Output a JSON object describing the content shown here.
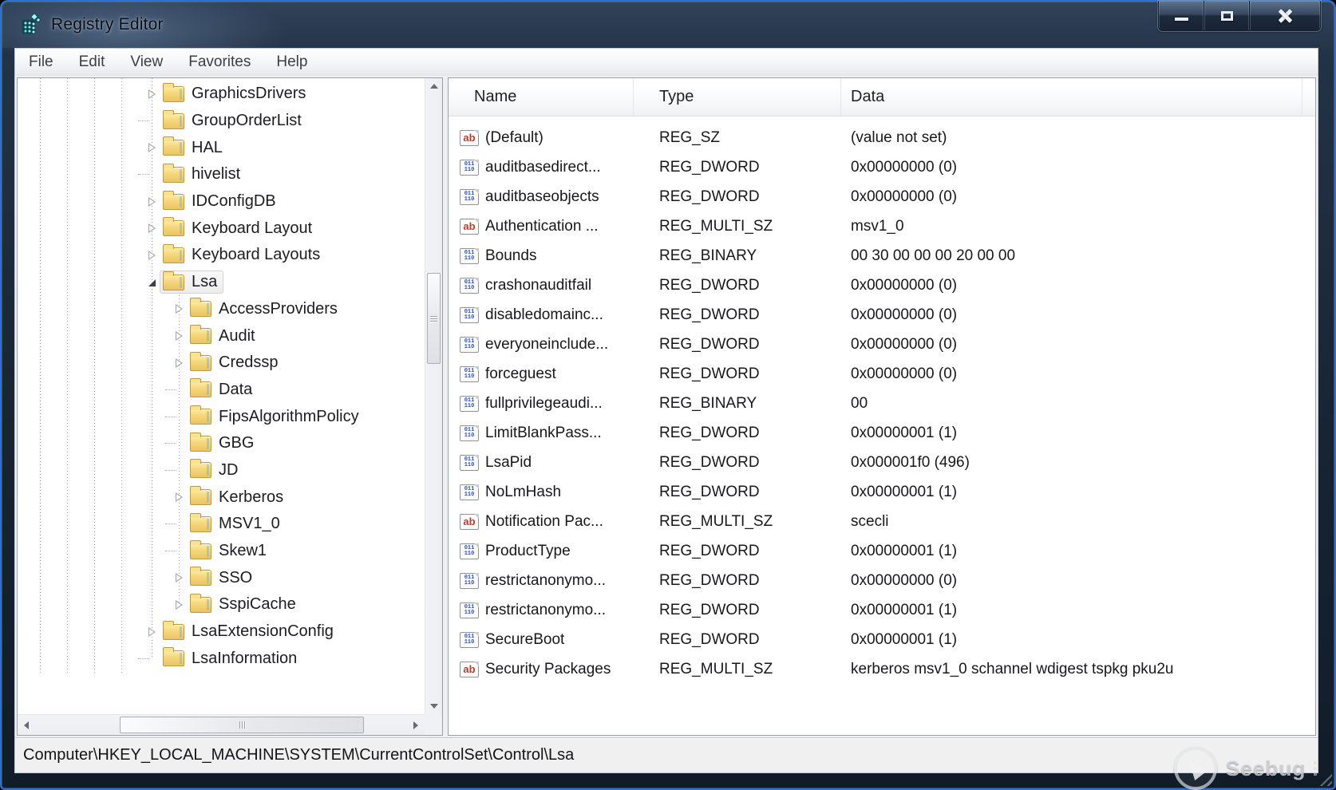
{
  "window": {
    "title": "Registry Editor",
    "controls": [
      {
        "name": "minimize",
        "glyph": "minimize-bar"
      },
      {
        "name": "maximize",
        "glyph": "maximize-square"
      },
      {
        "name": "close",
        "glyph": "close-x"
      }
    ]
  },
  "menu": {
    "items": [
      "File",
      "Edit",
      "View",
      "Favorites",
      "Help"
    ]
  },
  "tree": {
    "items": [
      {
        "label": "GraphicsDrivers",
        "level": 0,
        "state": "collapsed",
        "selected": false
      },
      {
        "label": "GroupOrderList",
        "level": 0,
        "state": "leaf",
        "selected": false
      },
      {
        "label": "HAL",
        "level": 0,
        "state": "collapsed",
        "selected": false
      },
      {
        "label": "hivelist",
        "level": 0,
        "state": "leaf",
        "selected": false
      },
      {
        "label": "IDConfigDB",
        "level": 0,
        "state": "collapsed",
        "selected": false
      },
      {
        "label": "Keyboard Layout",
        "level": 0,
        "state": "collapsed",
        "selected": false
      },
      {
        "label": "Keyboard Layouts",
        "level": 0,
        "state": "collapsed",
        "selected": false
      },
      {
        "label": "Lsa",
        "level": 0,
        "state": "expanded",
        "selected": true
      },
      {
        "label": "AccessProviders",
        "level": 1,
        "state": "collapsed",
        "selected": false
      },
      {
        "label": "Audit",
        "level": 1,
        "state": "collapsed",
        "selected": false
      },
      {
        "label": "Credssp",
        "level": 1,
        "state": "collapsed",
        "selected": false
      },
      {
        "label": "Data",
        "level": 1,
        "state": "leaf",
        "selected": false
      },
      {
        "label": "FipsAlgorithmPolicy",
        "level": 1,
        "state": "leaf",
        "selected": false
      },
      {
        "label": "GBG",
        "level": 1,
        "state": "leaf",
        "selected": false
      },
      {
        "label": "JD",
        "level": 1,
        "state": "leaf",
        "selected": false
      },
      {
        "label": "Kerberos",
        "level": 1,
        "state": "collapsed",
        "selected": false
      },
      {
        "label": "MSV1_0",
        "level": 1,
        "state": "leaf",
        "selected": false
      },
      {
        "label": "Skew1",
        "level": 1,
        "state": "leaf",
        "selected": false
      },
      {
        "label": "SSO",
        "level": 1,
        "state": "collapsed",
        "selected": false
      },
      {
        "label": "SspiCache",
        "level": 1,
        "state": "collapsed",
        "selected": false
      },
      {
        "label": "LsaExtensionConfig",
        "level": 0,
        "state": "collapsed",
        "selected": false
      },
      {
        "label": "LsaInformation",
        "level": 0,
        "state": "leaf",
        "selected": false
      }
    ]
  },
  "list": {
    "columns": [
      "Name",
      "Type",
      "Data"
    ],
    "rows": [
      {
        "icon": "string",
        "name": "(Default)",
        "type": "REG_SZ",
        "data": "(value not set)"
      },
      {
        "icon": "binary",
        "name": "auditbasedirect...",
        "type": "REG_DWORD",
        "data": "0x00000000 (0)"
      },
      {
        "icon": "binary",
        "name": "auditbaseobjects",
        "type": "REG_DWORD",
        "data": "0x00000000 (0)"
      },
      {
        "icon": "string",
        "name": "Authentication ...",
        "type": "REG_MULTI_SZ",
        "data": "msv1_0"
      },
      {
        "icon": "binary",
        "name": "Bounds",
        "type": "REG_BINARY",
        "data": "00 30 00 00 00 20 00 00"
      },
      {
        "icon": "binary",
        "name": "crashonauditfail",
        "type": "REG_DWORD",
        "data": "0x00000000 (0)"
      },
      {
        "icon": "binary",
        "name": "disabledomainc...",
        "type": "REG_DWORD",
        "data": "0x00000000 (0)"
      },
      {
        "icon": "binary",
        "name": "everyoneinclude...",
        "type": "REG_DWORD",
        "data": "0x00000000 (0)"
      },
      {
        "icon": "binary",
        "name": "forceguest",
        "type": "REG_DWORD",
        "data": "0x00000000 (0)"
      },
      {
        "icon": "binary",
        "name": "fullprivilegeaudi...",
        "type": "REG_BINARY",
        "data": "00"
      },
      {
        "icon": "binary",
        "name": "LimitBlankPass...",
        "type": "REG_DWORD",
        "data": "0x00000001 (1)"
      },
      {
        "icon": "binary",
        "name": "LsaPid",
        "type": "REG_DWORD",
        "data": "0x000001f0 (496)"
      },
      {
        "icon": "binary",
        "name": "NoLmHash",
        "type": "REG_DWORD",
        "data": "0x00000001 (1)"
      },
      {
        "icon": "string",
        "name": "Notification Pac...",
        "type": "REG_MULTI_SZ",
        "data": "scecli"
      },
      {
        "icon": "binary",
        "name": "ProductType",
        "type": "REG_DWORD",
        "data": "0x00000001 (1)"
      },
      {
        "icon": "binary",
        "name": "restrictanonymo...",
        "type": "REG_DWORD",
        "data": "0x00000000 (0)"
      },
      {
        "icon": "binary",
        "name": "restrictanonymo...",
        "type": "REG_DWORD",
        "data": "0x00000001 (1)"
      },
      {
        "icon": "binary",
        "name": "SecureBoot",
        "type": "REG_DWORD",
        "data": "0x00000001 (1)"
      },
      {
        "icon": "string",
        "name": "Security Packages",
        "type": "REG_MULTI_SZ",
        "data": "kerberos msv1_0 schannel wdigest tspkg pku2u"
      }
    ],
    "icon_glyphs": {
      "string": "ab",
      "binary_top": "011",
      "binary_bottom": "110"
    }
  },
  "statusbar": {
    "path": "Computer\\HKEY_LOCAL_MACHINE\\SYSTEM\\CurrentControlSet\\Control\\Lsa"
  },
  "watermark": {
    "label": "Seebug"
  },
  "colors": {
    "frame_border": "#2e6fd0",
    "titlebar_dark": "#182433",
    "folder_yellow": "#f5d87e",
    "string_icon_red": "#c03a2b",
    "binary_icon_blue": "#2a51c0",
    "pane_border": "#99a0a8",
    "status_bg": "#f0f0f0"
  }
}
